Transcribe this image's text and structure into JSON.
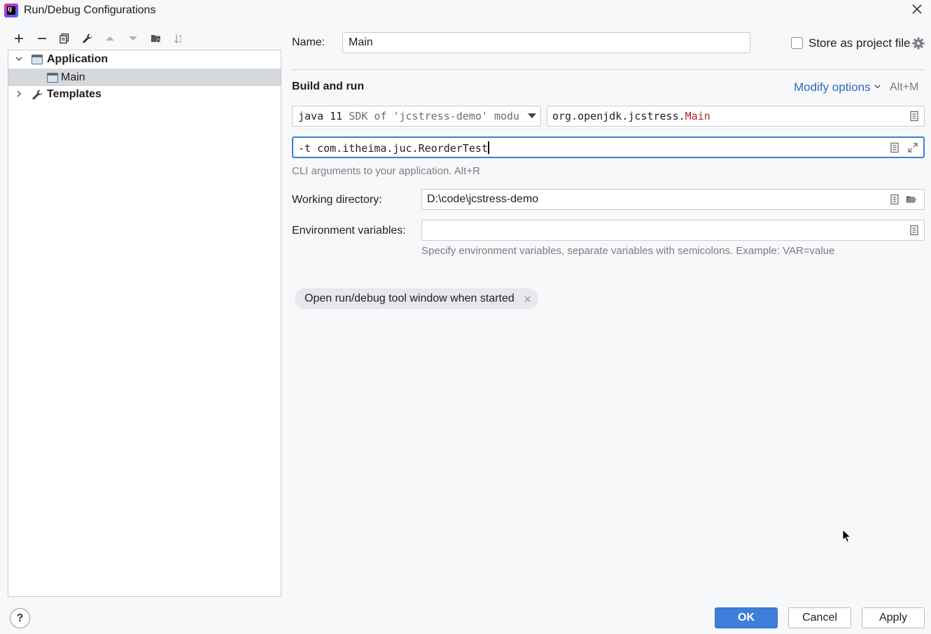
{
  "window": {
    "title": "Run/Debug Configurations",
    "logo_text": "IJ"
  },
  "toolbar": {
    "icons": [
      "plus-icon",
      "minus-icon",
      "copy-icon",
      "wrench-icon",
      "arrow-up-icon",
      "arrow-down-icon",
      "new-folder-icon",
      "sort-icon"
    ]
  },
  "tree": {
    "items": [
      {
        "label": "Application",
        "expanded": true
      },
      {
        "label": "Main",
        "selected": true
      },
      {
        "label": "Templates",
        "expanded": false
      }
    ]
  },
  "form": {
    "name_label": "Name:",
    "name_value": "Main",
    "store_label": "Store as project file",
    "store_checked": false,
    "section_title": "Build and run",
    "modify_options": "Modify options",
    "modify_shortcut": "Alt+M",
    "sdk_java": "java 11",
    "sdk_desc": "SDK of 'jcstress-demo' modul",
    "main_class_pkg": "org.openjdk.jcstress.",
    "main_class_name": "Main",
    "args_value": "-t com.itheima.juc.ReorderTest",
    "args_hint": "CLI arguments to your application. Alt+R",
    "workdir_label": "Working directory:",
    "workdir_value": "D:\\code\\jcstress-demo",
    "env_label": "Environment variables:",
    "env_value": "",
    "env_hint": "Specify environment variables, separate variables with semicolons. Example: VAR=value",
    "chip_label": "Open run/debug tool window when started"
  },
  "buttons": {
    "help": "?",
    "ok": "OK",
    "cancel": "Cancel",
    "apply": "Apply"
  },
  "colors": {
    "accent": "#3d7edb",
    "link": "#2f6bc5",
    "class_name": "#b3261e"
  }
}
